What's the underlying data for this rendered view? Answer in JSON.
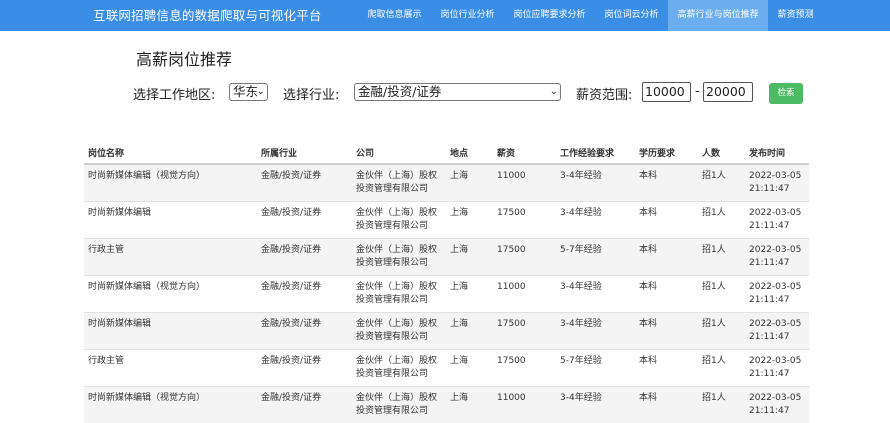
{
  "app": {
    "title": "互联网招聘信息的数据爬取与可视化平台"
  },
  "nav": {
    "items": [
      {
        "label": "爬取信息展示"
      },
      {
        "label": "岗位行业分析"
      },
      {
        "label": "岗位应聘要求分析"
      },
      {
        "label": "岗位词云分析"
      },
      {
        "label": "高薪行业与岗位推荐",
        "active": true
      },
      {
        "label": "薪资预测"
      }
    ]
  },
  "page": {
    "title": "高薪岗位推荐"
  },
  "filters": {
    "region_label": "选择工作地区:",
    "region_value": "华东",
    "industry_label": "选择行业:",
    "industry_value": "金融/投资/证券",
    "salary_label": "薪资范围:",
    "salary_min": "10000",
    "salary_sep": "-",
    "salary_max": "20000",
    "search_label": "检索"
  },
  "table": {
    "headers": [
      "岗位名称",
      "所属行业",
      "公司",
      "地点",
      "薪资",
      "工作经验要求",
      "学历要求",
      "人数",
      "发布时间"
    ],
    "rows": [
      [
        "时尚新媒体编辑（视觉方向）",
        "金融/投资/证券",
        "金伙伴（上海）股权投资管理有限公司",
        "上海",
        "11000",
        "3-4年经验",
        "本科",
        "招1人",
        "2022-03-05 21:11:47"
      ],
      [
        "时尚新媒体编辑",
        "金融/投资/证券",
        "金伙伴（上海）股权投资管理有限公司",
        "上海",
        "17500",
        "3-4年经验",
        "本科",
        "招1人",
        "2022-03-05 21:11:47"
      ],
      [
        "行政主管",
        "金融/投资/证券",
        "金伙伴（上海）股权投资管理有限公司",
        "上海",
        "17500",
        "5-7年经验",
        "本科",
        "招1人",
        "2022-03-05 21:11:47"
      ],
      [
        "时尚新媒体编辑（视觉方向）",
        "金融/投资/证券",
        "金伙伴（上海）股权投资管理有限公司",
        "上海",
        "11000",
        "3-4年经验",
        "本科",
        "招1人",
        "2022-03-05 21:11:47"
      ],
      [
        "时尚新媒体编辑",
        "金融/投资/证券",
        "金伙伴（上海）股权投资管理有限公司",
        "上海",
        "17500",
        "3-4年经验",
        "本科",
        "招1人",
        "2022-03-05 21:11:47"
      ],
      [
        "行政主管",
        "金融/投资/证券",
        "金伙伴（上海）股权投资管理有限公司",
        "上海",
        "17500",
        "5-7年经验",
        "本科",
        "招1人",
        "2022-03-05 21:11:47"
      ],
      [
        "时尚新媒体编辑（视觉方向）",
        "金融/投资/证券",
        "金伙伴（上海）股权投资管理有限公司",
        "上海",
        "11000",
        "3-4年经验",
        "本科",
        "招1人",
        "2022-03-05 21:11:47"
      ]
    ]
  }
}
